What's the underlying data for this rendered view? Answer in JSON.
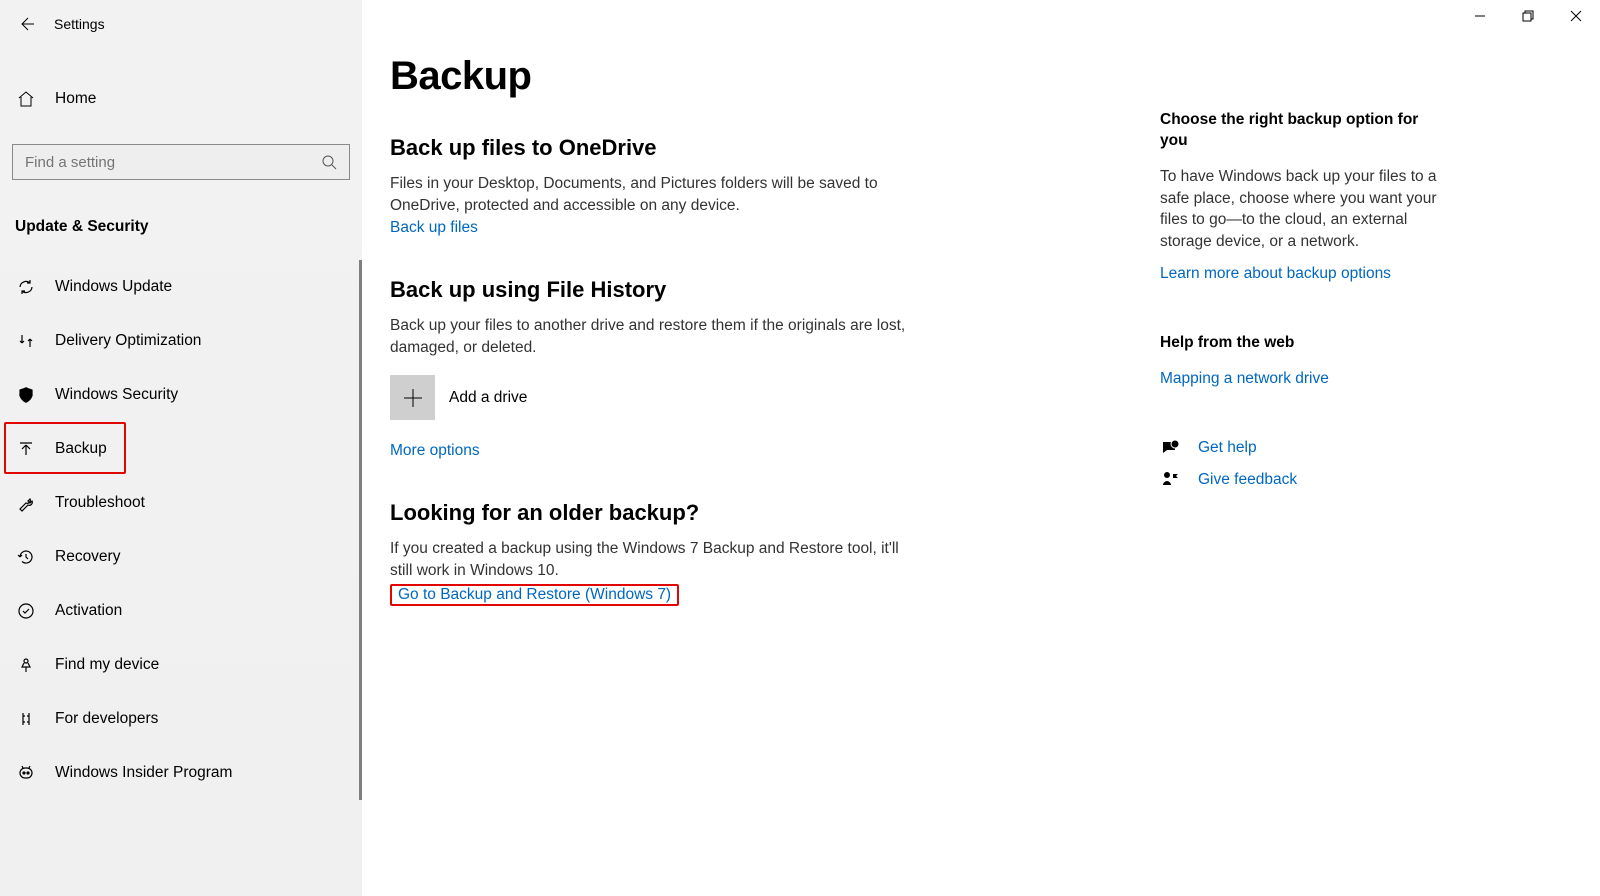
{
  "window": {
    "title": "Settings"
  },
  "sidebar": {
    "home_label": "Home",
    "search_placeholder": "Find a setting",
    "category_header": "Update & Security",
    "items": [
      {
        "label": "Windows Update",
        "icon": "sync-icon"
      },
      {
        "label": "Delivery Optimization",
        "icon": "transfer-icon"
      },
      {
        "label": "Windows Security",
        "icon": "shield-icon"
      },
      {
        "label": "Backup",
        "icon": "upload-icon",
        "selected": true
      },
      {
        "label": "Troubleshoot",
        "icon": "wrench-icon"
      },
      {
        "label": "Recovery",
        "icon": "clock-icon"
      },
      {
        "label": "Activation",
        "icon": "check-icon"
      },
      {
        "label": "Find my device",
        "icon": "pin-icon"
      },
      {
        "label": "For developers",
        "icon": "dev-icon"
      },
      {
        "label": "Windows Insider Program",
        "icon": "insider-icon"
      }
    ]
  },
  "main": {
    "title": "Backup",
    "onedrive": {
      "heading": "Back up files to OneDrive",
      "body": "Files in your Desktop, Documents, and Pictures folders will be saved to OneDrive, protected and accessible on any device.",
      "link": "Back up files"
    },
    "filehistory": {
      "heading": "Back up using File History",
      "body": "Back up your files to another drive and restore them if the originals are lost, damaged, or deleted.",
      "add_drive": "Add a drive",
      "more_options_link": "More options"
    },
    "older": {
      "heading": "Looking for an older backup?",
      "body": "If you created a backup using the Windows 7 Backup and Restore tool, it'll still work in Windows 10.",
      "link": "Go to Backup and Restore (Windows 7)"
    }
  },
  "right": {
    "choose": {
      "heading": "Choose the right backup option for you",
      "body": "To have Windows back up your files to a safe place, choose where you want your files to go—to the cloud, an external storage device, or a network.",
      "link": "Learn more about backup options"
    },
    "help": {
      "heading": "Help from the web",
      "link": "Mapping a network drive"
    },
    "actions": {
      "get_help": "Get help",
      "give_feedback": "Give feedback"
    }
  }
}
